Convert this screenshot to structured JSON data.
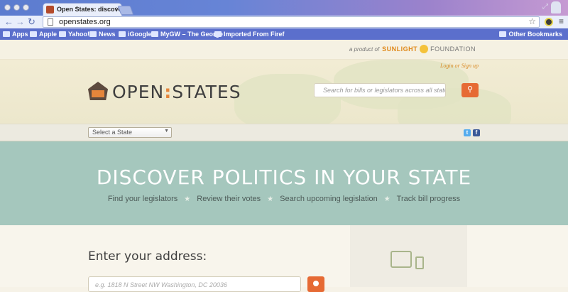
{
  "browser": {
    "tab_title": "Open States: discover poli",
    "tab_close": "×",
    "url": "openstates.org",
    "bookmarks": [
      {
        "label": "Apps"
      },
      {
        "label": "Apple"
      },
      {
        "label": "Yahoo!"
      },
      {
        "label": "News"
      },
      {
        "label": "iGoogle"
      },
      {
        "label": "MyGW – The George"
      },
      {
        "label": "Imported From Firef"
      }
    ],
    "other_bookmarks": "Other Bookmarks"
  },
  "site": {
    "product_of": "a product of",
    "sunlight": "SUNLIGHT",
    "foundation": "FOUNDATION",
    "login": "Login or Sign up",
    "logo_open": "OPEN",
    "logo_colon": ":",
    "logo_states": "STATES",
    "search_placeholder": "Search for bills or legislators across all state",
    "state_select": "Select a State",
    "colors": {
      "accent": "#e66a34",
      "hero": "#a5c7bd"
    }
  },
  "hero": {
    "title": "DISCOVER POLITICS IN YOUR STATE",
    "links": [
      "Find your legislators",
      "Review their votes",
      "Search upcoming legislation",
      "Track bill progress"
    ],
    "separator": "★"
  },
  "main": {
    "address_label": "Enter your address:",
    "address_placeholder": "e.g. 1818 N Street NW Washington, DC 20036"
  },
  "icons": [
    "back-icon",
    "forward-icon",
    "reload-icon",
    "star-icon",
    "menu-icon",
    "search-icon",
    "twitter-icon",
    "facebook-icon",
    "device-icon"
  ]
}
